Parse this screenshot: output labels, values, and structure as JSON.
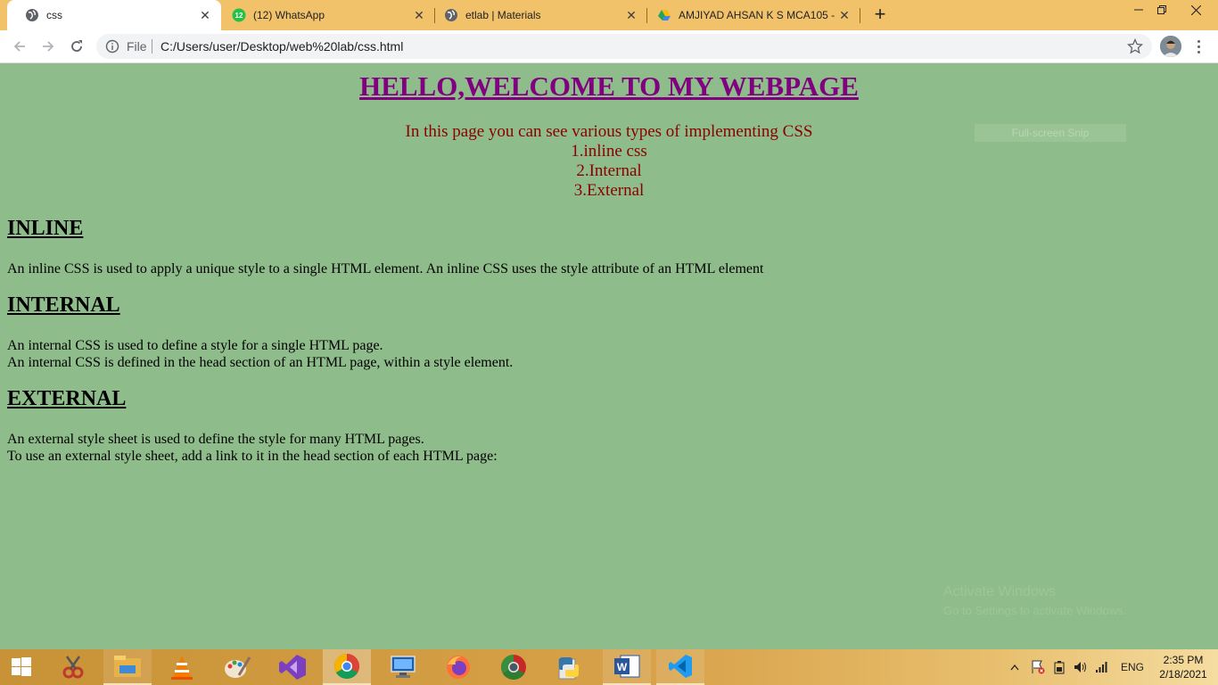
{
  "browser": {
    "tabs": [
      {
        "title": "css",
        "favicon": "globe-icon",
        "active": true
      },
      {
        "title": "(12) WhatsApp",
        "favicon": "whatsapp-icon",
        "badge": "12",
        "active": false
      },
      {
        "title": "etlab | Materials",
        "favicon": "globe-icon",
        "active": false
      },
      {
        "title": "AMJIYAD AHSAN K S MCA105 - (",
        "favicon": "google-drive-icon",
        "active": false
      }
    ],
    "new_tab_label": "+",
    "address": {
      "scheme_label": "File",
      "url": "C:/Users/user/Desktop/web%20lab/css.html"
    }
  },
  "page": {
    "title": "HELLO,WELCOME TO MY WEBPAGE",
    "intro": {
      "line1": "In this page you can see various types of implementing CSS",
      "line2": "1.inline css",
      "line3": "2.Internal",
      "line4": "3.External"
    },
    "sections": [
      {
        "heading": "INLINE",
        "lines": [
          "An inline CSS is used to apply a unique style to a single HTML element. An inline CSS uses the style attribute of an HTML element"
        ]
      },
      {
        "heading": "INTERNAL",
        "lines": [
          "An internal CSS is used to define a style for a single HTML page.",
          "An internal CSS is defined in the head section of an HTML page, within a style element."
        ]
      },
      {
        "heading": "EXTERNAL",
        "lines": [
          "An external style sheet is used to define the style for many HTML pages.",
          "To use an external style sheet, add a link to it in the head section of each HTML page:"
        ]
      }
    ],
    "snip_hint": "Full-screen Snip",
    "watermark": {
      "line1": "Activate Windows",
      "line2": "Go to Settings to activate Windows."
    }
  },
  "colors": {
    "page_background": "#8fbc8b",
    "title": "#800080",
    "intro": "#8b0000",
    "tab_strip": "#f2c26b",
    "taskbar": "#d8a24a"
  },
  "taskbar": {
    "pinned": [
      "start-icon",
      "snipping-tool-icon",
      "file-explorer-icon",
      "vlc-icon",
      "paint-icon",
      "visual-studio-icon",
      "chrome-icon",
      "remote-desktop-icon",
      "firefox-icon",
      "chrome-alt-icon",
      "python-icon",
      "word-icon",
      "vscode-icon"
    ],
    "tray": {
      "language": "ENG",
      "time": "2:35 PM",
      "date": "2/18/2021"
    }
  }
}
